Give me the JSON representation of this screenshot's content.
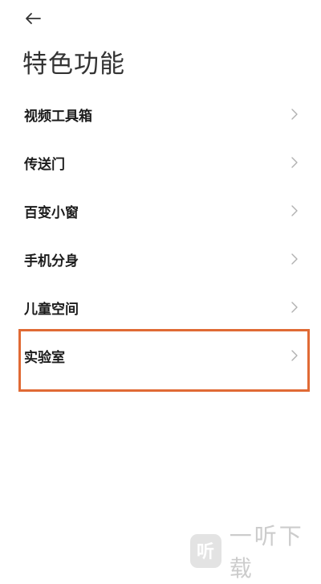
{
  "header": {
    "back_icon": "arrow-left-icon",
    "title": "特色功能"
  },
  "menu": {
    "items": [
      {
        "label": "视频工具箱",
        "icon": "chevron-right-icon"
      },
      {
        "label": "传送门",
        "icon": "chevron-right-icon"
      },
      {
        "label": "百变小窗",
        "icon": "chevron-right-icon"
      },
      {
        "label": "手机分身",
        "icon": "chevron-right-icon"
      },
      {
        "label": "儿童空间",
        "icon": "chevron-right-icon"
      },
      {
        "label": "实验室",
        "icon": "chevron-right-icon"
      }
    ]
  },
  "annotation": {
    "highlight_color": "#e06a35",
    "highlighted_item": "实验室"
  },
  "watermark": {
    "logo_text": "听",
    "text": "一听下载"
  }
}
